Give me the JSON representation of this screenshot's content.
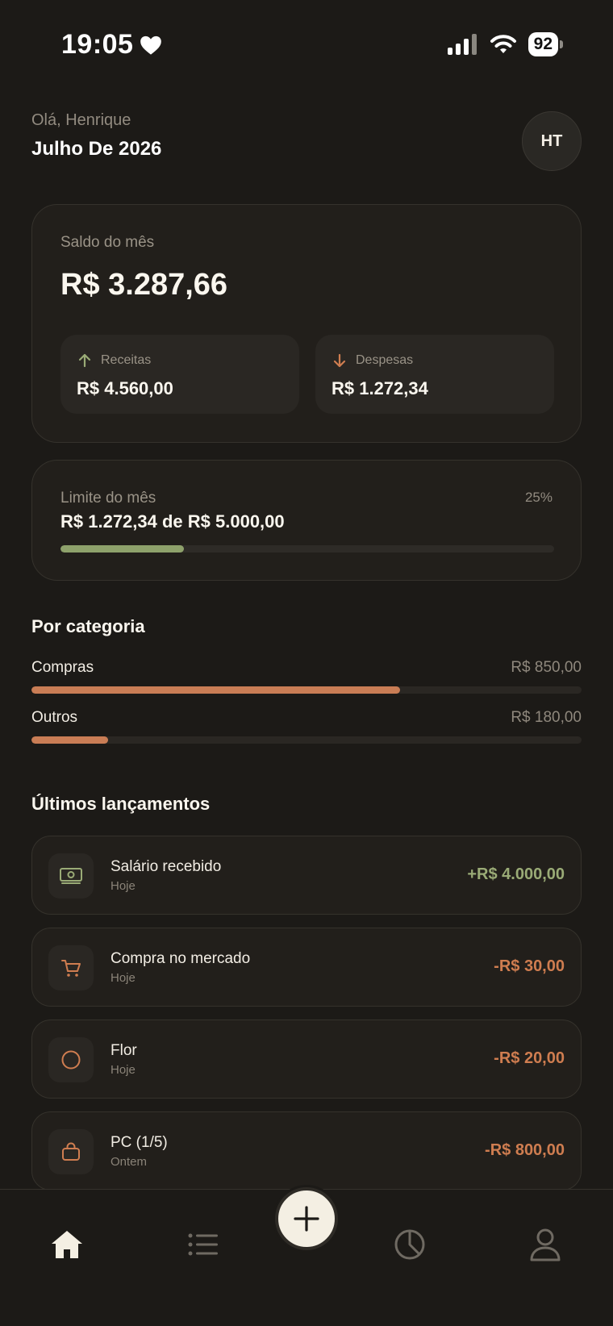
{
  "status": {
    "time": "19:05",
    "battery": "92"
  },
  "header": {
    "greeting": "Olá, Henrique",
    "month": "Julho De 2026",
    "avatar_initials": "HT"
  },
  "balance": {
    "label": "Saldo do mês",
    "value": "R$ 3.287,66",
    "income_label": "Receitas",
    "income_value": "R$ 4.560,00",
    "expense_label": "Despesas",
    "expense_value": "R$ 1.272,34"
  },
  "limit": {
    "label": "Limite do mês",
    "value": "R$ 1.272,34 de R$ 5.000,00",
    "percent_label": "25%",
    "percent": 25
  },
  "categories": {
    "title": "Por categoria",
    "items": [
      {
        "name": "Compras",
        "amount": "R$ 850,00",
        "fraction": 0.67
      },
      {
        "name": "Outros",
        "amount": "R$ 180,00",
        "fraction": 0.14
      }
    ]
  },
  "transactions": {
    "title": "Últimos lançamentos",
    "items": [
      {
        "title": "Salário recebido",
        "date": "Hoje",
        "amount": "+R$ 4.000,00",
        "icon": "money-icon"
      },
      {
        "title": "Compra no mercado",
        "date": "Hoje",
        "amount": "-R$ 30,00",
        "icon": "cart-icon"
      },
      {
        "title": "Flor",
        "date": "Hoje",
        "amount": "-R$ 20,00",
        "icon": "circle-icon"
      },
      {
        "title": "PC (1/5)",
        "date": "Ontem",
        "amount": "-R$ 800,00",
        "icon": "shopping-bag-icon"
      }
    ]
  },
  "colors": {
    "background": "#1c1a17",
    "income_green": "#9aab76",
    "expense_orange": "#cf7d50",
    "limit_bar": "#8ea16b",
    "category_bar": "#c97d55",
    "fab": "#f4efe3"
  },
  "nav": {
    "items": [
      "home-icon",
      "list-icon",
      "plus-icon",
      "pie-chart-icon",
      "user-icon"
    ],
    "active": "home-icon"
  }
}
